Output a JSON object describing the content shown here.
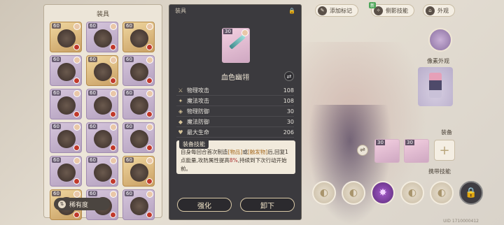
{
  "inventory": {
    "title": "装具",
    "levels": [
      "60",
      "60",
      "60",
      "60",
      "60",
      "60",
      "60",
      "60",
      "60",
      "60",
      "60",
      "60",
      "60",
      "60",
      "60",
      "60",
      "60",
      "60"
    ],
    "rarity_button": "稀有度"
  },
  "detail": {
    "title": "装具",
    "item_level": "30",
    "item_name": "血色幽翎",
    "stats": [
      {
        "name": "物理攻击",
        "value": "108",
        "icon": "sword-icon"
      },
      {
        "name": "魔法攻击",
        "value": "108",
        "icon": "wand-icon"
      },
      {
        "name": "物理防御",
        "value": "30",
        "icon": "shield-icon"
      },
      {
        "name": "魔法防御",
        "value": "30",
        "icon": "magic-shield-icon"
      },
      {
        "name": "最大生命",
        "value": "206",
        "icon": "heart-icon"
      }
    ],
    "skill_title": "装备技能",
    "skill_text_1": "自身每回合首次制造",
    "skill_kw_1": "[物品]",
    "skill_text_2": "或",
    "skill_kw_2": "[触发物]",
    "skill_text_3": "后,回复1点能量,攻防属性提高",
    "skill_pct": "8%",
    "skill_text_4": ",持续到下次行动开始前。",
    "enhance": "强化",
    "unequip": "卸下"
  },
  "top": {
    "add_mark": "添加标记",
    "side_skill": "侧影技能",
    "new": "新",
    "appearance": "外观"
  },
  "right": {
    "pixel_label": "像素外观",
    "equip_label": "装备",
    "carry_label": "携带技能",
    "equip_levels": [
      "30",
      "30"
    ],
    "uid": "UID 1710000412"
  }
}
